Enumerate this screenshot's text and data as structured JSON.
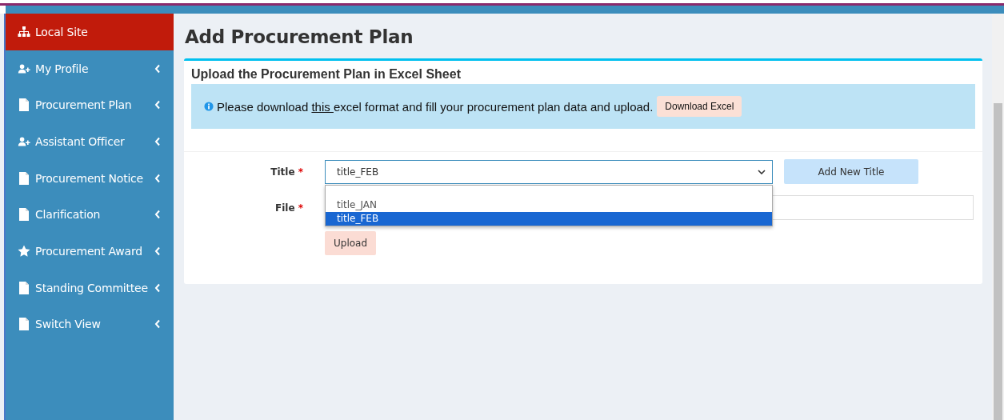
{
  "sidebar": {
    "items": [
      {
        "label": "Local Site",
        "kind": "sitemap",
        "selected": true,
        "expandable": false
      },
      {
        "label": "My Profile",
        "kind": "user",
        "selected": false,
        "expandable": true
      },
      {
        "label": "Procurement Plan",
        "kind": "file",
        "selected": false,
        "expandable": true
      },
      {
        "label": "Assistant Officer",
        "kind": "user",
        "selected": false,
        "expandable": true
      },
      {
        "label": "Procurement Notice",
        "kind": "file",
        "selected": false,
        "expandable": true
      },
      {
        "label": "Clarification",
        "kind": "file",
        "selected": false,
        "expandable": true
      },
      {
        "label": "Procurement Award",
        "kind": "star",
        "selected": false,
        "expandable": true
      },
      {
        "label": "Standing Committee",
        "kind": "file",
        "selected": false,
        "expandable": true
      },
      {
        "label": "Switch View",
        "kind": "file",
        "selected": false,
        "expandable": true
      }
    ]
  },
  "page_title": "Add Procurement Plan",
  "card": {
    "heading": "Upload the Procurement Plan in Excel Sheet",
    "notice": {
      "before": "Please download ",
      "link": "this ",
      "after": "excel format and fill your procurement plan data and upload.",
      "button": "Download Excel"
    },
    "form": {
      "title_field": {
        "label": "Title",
        "required_mark": "*",
        "value": "title_FEB",
        "expanded": true,
        "options": [
          {
            "label": "title_JAN",
            "selected": false
          },
          {
            "label": "title_FEB",
            "selected": true
          }
        ]
      },
      "add_button": "Add New Title",
      "file_field": {
        "label": "File",
        "required_mark": "*"
      },
      "upload_button": "Upload"
    }
  }
}
